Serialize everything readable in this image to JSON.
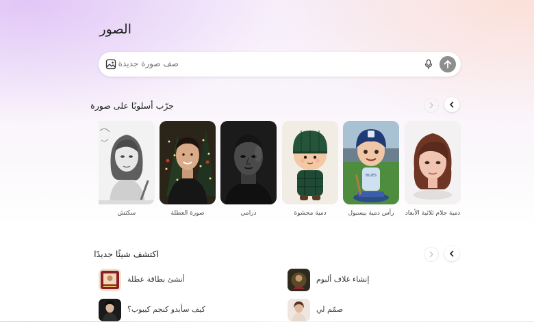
{
  "page_title": "الصور",
  "search": {
    "placeholder": "صف صورة جديدة"
  },
  "styles_section": {
    "title": "جرّب أسلوبًا على صورة",
    "cards": [
      {
        "label": "دمية جلام ثلاثية الأبعاد"
      },
      {
        "label": "رأس دمية بيسبول"
      },
      {
        "label": "دمية محشوة"
      },
      {
        "label": "درامي"
      },
      {
        "label": "صورة العطلة"
      },
      {
        "label": "سكتش"
      }
    ],
    "jersey_text": "BLUES"
  },
  "discover_section": {
    "title": "اكتشف شيئًا جديدًا",
    "items": [
      {
        "label": "إنشاء غلاف ألبوم"
      },
      {
        "label": "أنشئ بطاقة عطلة"
      },
      {
        "label": "صمّم لي"
      },
      {
        "label": "كيف سأبدو كنجم كيبوب؟"
      }
    ]
  },
  "colors": {
    "accent": "#8e8e8e"
  }
}
